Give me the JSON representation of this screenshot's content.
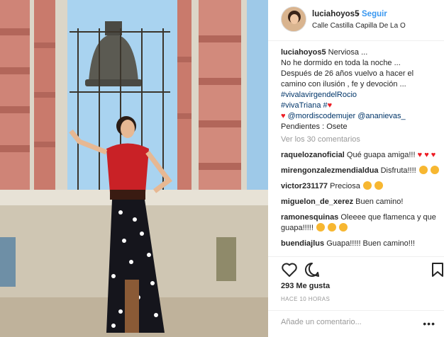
{
  "header": {
    "username": "luciahoyos5",
    "separator": "•",
    "follow_label": "Seguir",
    "location": "Calle Castilla Capilla De La O"
  },
  "caption": {
    "username": "luciahoyos5",
    "line1": "Nerviosa ...",
    "line2": "No he dormido en toda la noche ...",
    "line3": "Después de 26 años vuelvo a hacer el",
    "line4": "camino con ilusión , fe y devoción ...",
    "hashtag1": "#vivalavirgendelRocio",
    "hashtag2": "#vivaTriana #",
    "mention1": "@mordiscodemujer",
    "mention2": "@ananievas_",
    "pending": "Pendientes : Osete"
  },
  "view_all": "Ver los 30 comentarios",
  "comments": [
    {
      "user": "raquelozanoficial",
      "text": "Qué guapa amiga!!!"
    },
    {
      "user": "mirengonzalezmendialdua",
      "text": "Disfruta!!!!"
    },
    {
      "user": "victor231177",
      "text": "Preciosa"
    },
    {
      "user": "miguelon_de_xerez",
      "text": "Buen camino!"
    },
    {
      "user": "ramonesquinas",
      "text": "Oleeee que flamenca y que guapa!!!!!"
    },
    {
      "user": "buendiajlus",
      "text": "Guapa!!!!! Buen camino!!!"
    }
  ],
  "likes": "293 Me gusta",
  "time": "HACE 10 HORAS",
  "add_comment_placeholder": "Añade un comentario...",
  "more_label": "•••",
  "icons": [
    "heart-icon",
    "comment-icon",
    "bookmark-icon"
  ],
  "colors": {
    "follow": "#3897f0",
    "link": "#003569",
    "muted": "#999999"
  }
}
